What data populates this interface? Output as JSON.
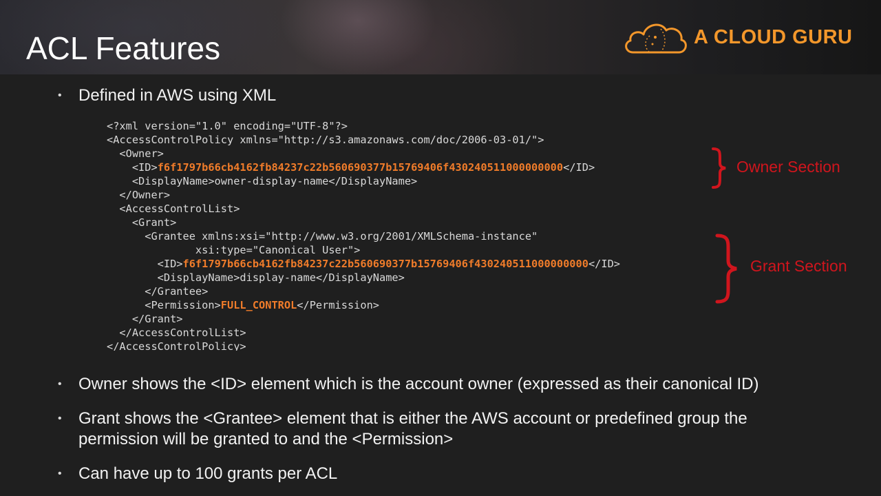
{
  "slide": {
    "title": "ACL Features",
    "logo_text": "A CLOUD GURU",
    "bullets": [
      "Defined in AWS using XML",
      "Owner shows the <ID> element which is the account owner (expressed as their canonical ID)",
      "Grant shows the <Grantee> element that is either the AWS account or predefined group the permission will be granted to and the <Permission>",
      "Can have up to 100 grants per ACL"
    ],
    "bullet_symbol": "•"
  },
  "code": {
    "lines": [
      "<?xml version=\"1.0\" encoding=\"UTF-8\"?>",
      "<AccessControlPolicy xmlns=\"http://s3.amazonaws.com/doc/2006-03-01/\">",
      "  <Owner>",
      "    <ID>",
      "f6f1797b66cb4162fb84237c22b560690377b15769406f430240511000000000",
      "</ID>",
      "    <DisplayName>owner-display-name</DisplayName>",
      "  </Owner>",
      "  <AccessControlList>",
      "    <Grant>",
      "      <Grantee xmlns:xsi=\"http://www.w3.org/2001/XMLSchema-instance\"",
      "              xsi:type=\"Canonical User\">",
      "        <ID>",
      "f6f1797b66cb4162fb84237c22b560690377b15769406f430240511000000000",
      "</ID>",
      "        <DisplayName>display-name</DisplayName>",
      "      </Grantee>",
      "      <Permission>",
      "FULL_CONTROL",
      "</Permission>",
      "    </Grant>",
      "  </AccessControlList>",
      "</AccessControlPolicy>"
    ]
  },
  "annotations": {
    "owner_label": "Owner Section",
    "grant_label": "Grant Section"
  },
  "colors": {
    "accent_orange": "#f3972b",
    "code_highlight": "#f07c2a",
    "annotation_red": "#d0151d",
    "background": "#1f1f1f"
  }
}
